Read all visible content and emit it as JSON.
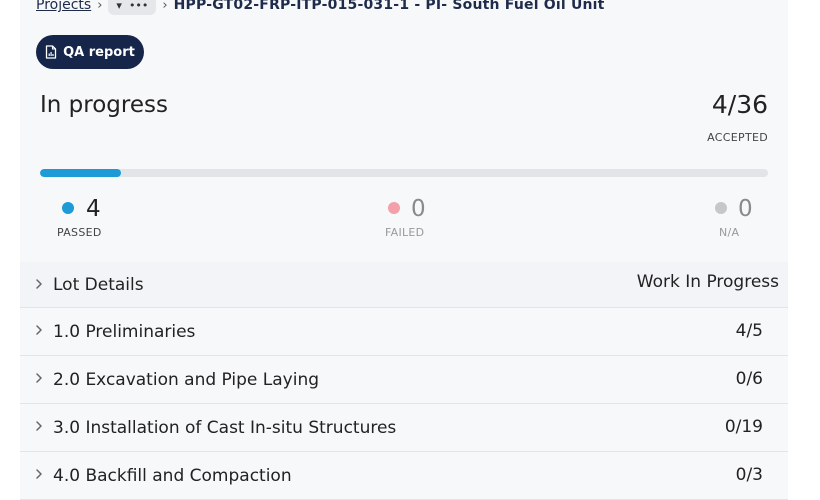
{
  "breadcrumb": {
    "projects_label": "Projects",
    "more_label": "•••",
    "current": "HPP-GT02-FRP-ITP-015-031-1 - PI- South Fuel Oil Unit"
  },
  "qa_report": {
    "label": "QA report"
  },
  "status": {
    "title": "In progress",
    "accepted": "4/36",
    "accepted_label": "ACCEPTED",
    "progress_fraction": 0.111
  },
  "stats": {
    "passed": {
      "value": "4",
      "label": "PASSED",
      "color": "#1d9bd7"
    },
    "failed": {
      "value": "0",
      "label": "FAILED",
      "color": "#f3a0a8"
    },
    "na": {
      "value": "0",
      "label": "N/A",
      "color": "#c7c7c7"
    }
  },
  "sections": [
    {
      "name": "Lot Details",
      "value": "Work In Progress"
    },
    {
      "name": "1.0 Preliminaries",
      "value": "4/5"
    },
    {
      "name": "2.0 Excavation and Pipe Laying",
      "value": "0/6"
    },
    {
      "name": "3.0 Installation of Cast In-situ Structures",
      "value": "0/19"
    },
    {
      "name": "4.0 Backfill and Compaction",
      "value": "0/3"
    }
  ],
  "colors": {
    "accent": "#1d9bd7",
    "brand": "#15264a"
  }
}
